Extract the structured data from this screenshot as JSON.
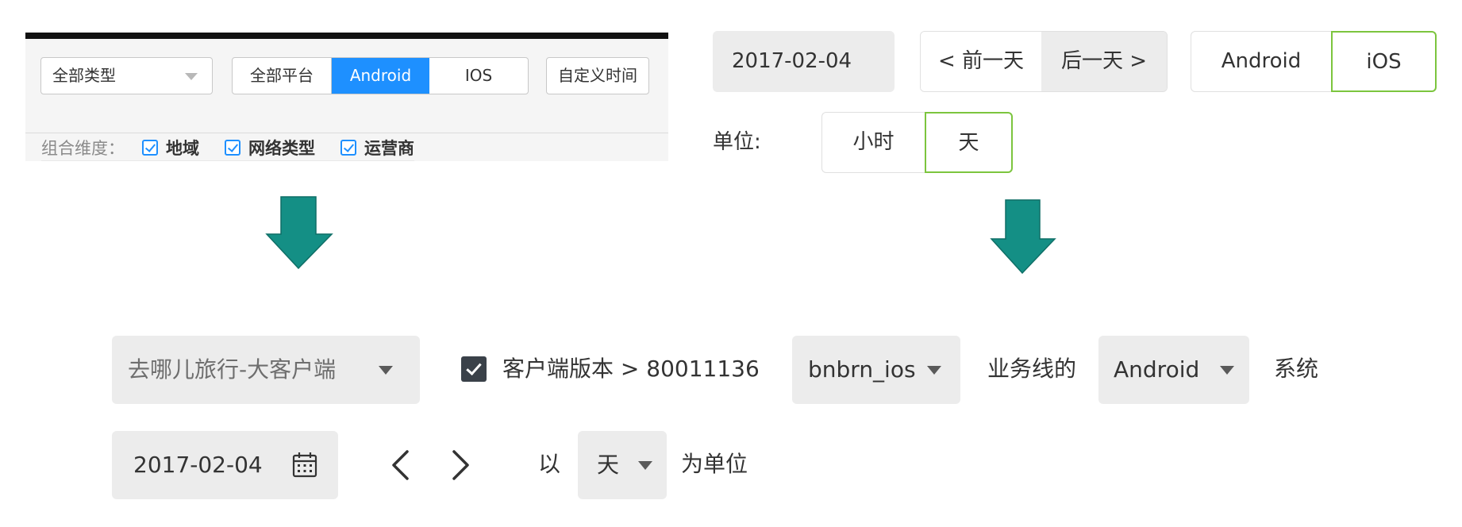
{
  "old_panel": {
    "type_select": "全部类型",
    "platform_segments": [
      "全部平台",
      "Android",
      "IOS"
    ],
    "active_platform": "Android",
    "custom_time": "自定义时间",
    "dimension_label": "组合维度：",
    "dimensions": [
      "地域",
      "网络类型",
      "运营商"
    ]
  },
  "old_date_panel": {
    "date": "2017-02-04",
    "prev_day": "< 前一天",
    "next_day": "后一天 >",
    "platforms": [
      "Android",
      "iOS"
    ],
    "selected_platform": "iOS",
    "unit_label": "单位:",
    "units": [
      "小时",
      "天"
    ],
    "selected_unit": "天"
  },
  "new_bar": {
    "client": "去哪儿旅行-大客户端",
    "version_filter": "客户端版本 > 80011136",
    "version_checked": true,
    "business_line": "bnbrn_ios",
    "business_line_suffix": "业务线的",
    "system": "Android",
    "system_suffix": "系统",
    "date": "2017-02-04",
    "unit_prefix": "以",
    "unit": "天",
    "unit_suffix": "为单位"
  },
  "colors": {
    "accent_blue": "#1e90ff",
    "selected_green": "#7cc53e",
    "arrow_teal": "#148f85",
    "control_gray": "#ececec"
  },
  "icons": [
    "chevron-down-icon",
    "check-icon",
    "calendar-icon",
    "chevron-left-icon",
    "chevron-right-icon",
    "arrow-down-icon"
  ]
}
